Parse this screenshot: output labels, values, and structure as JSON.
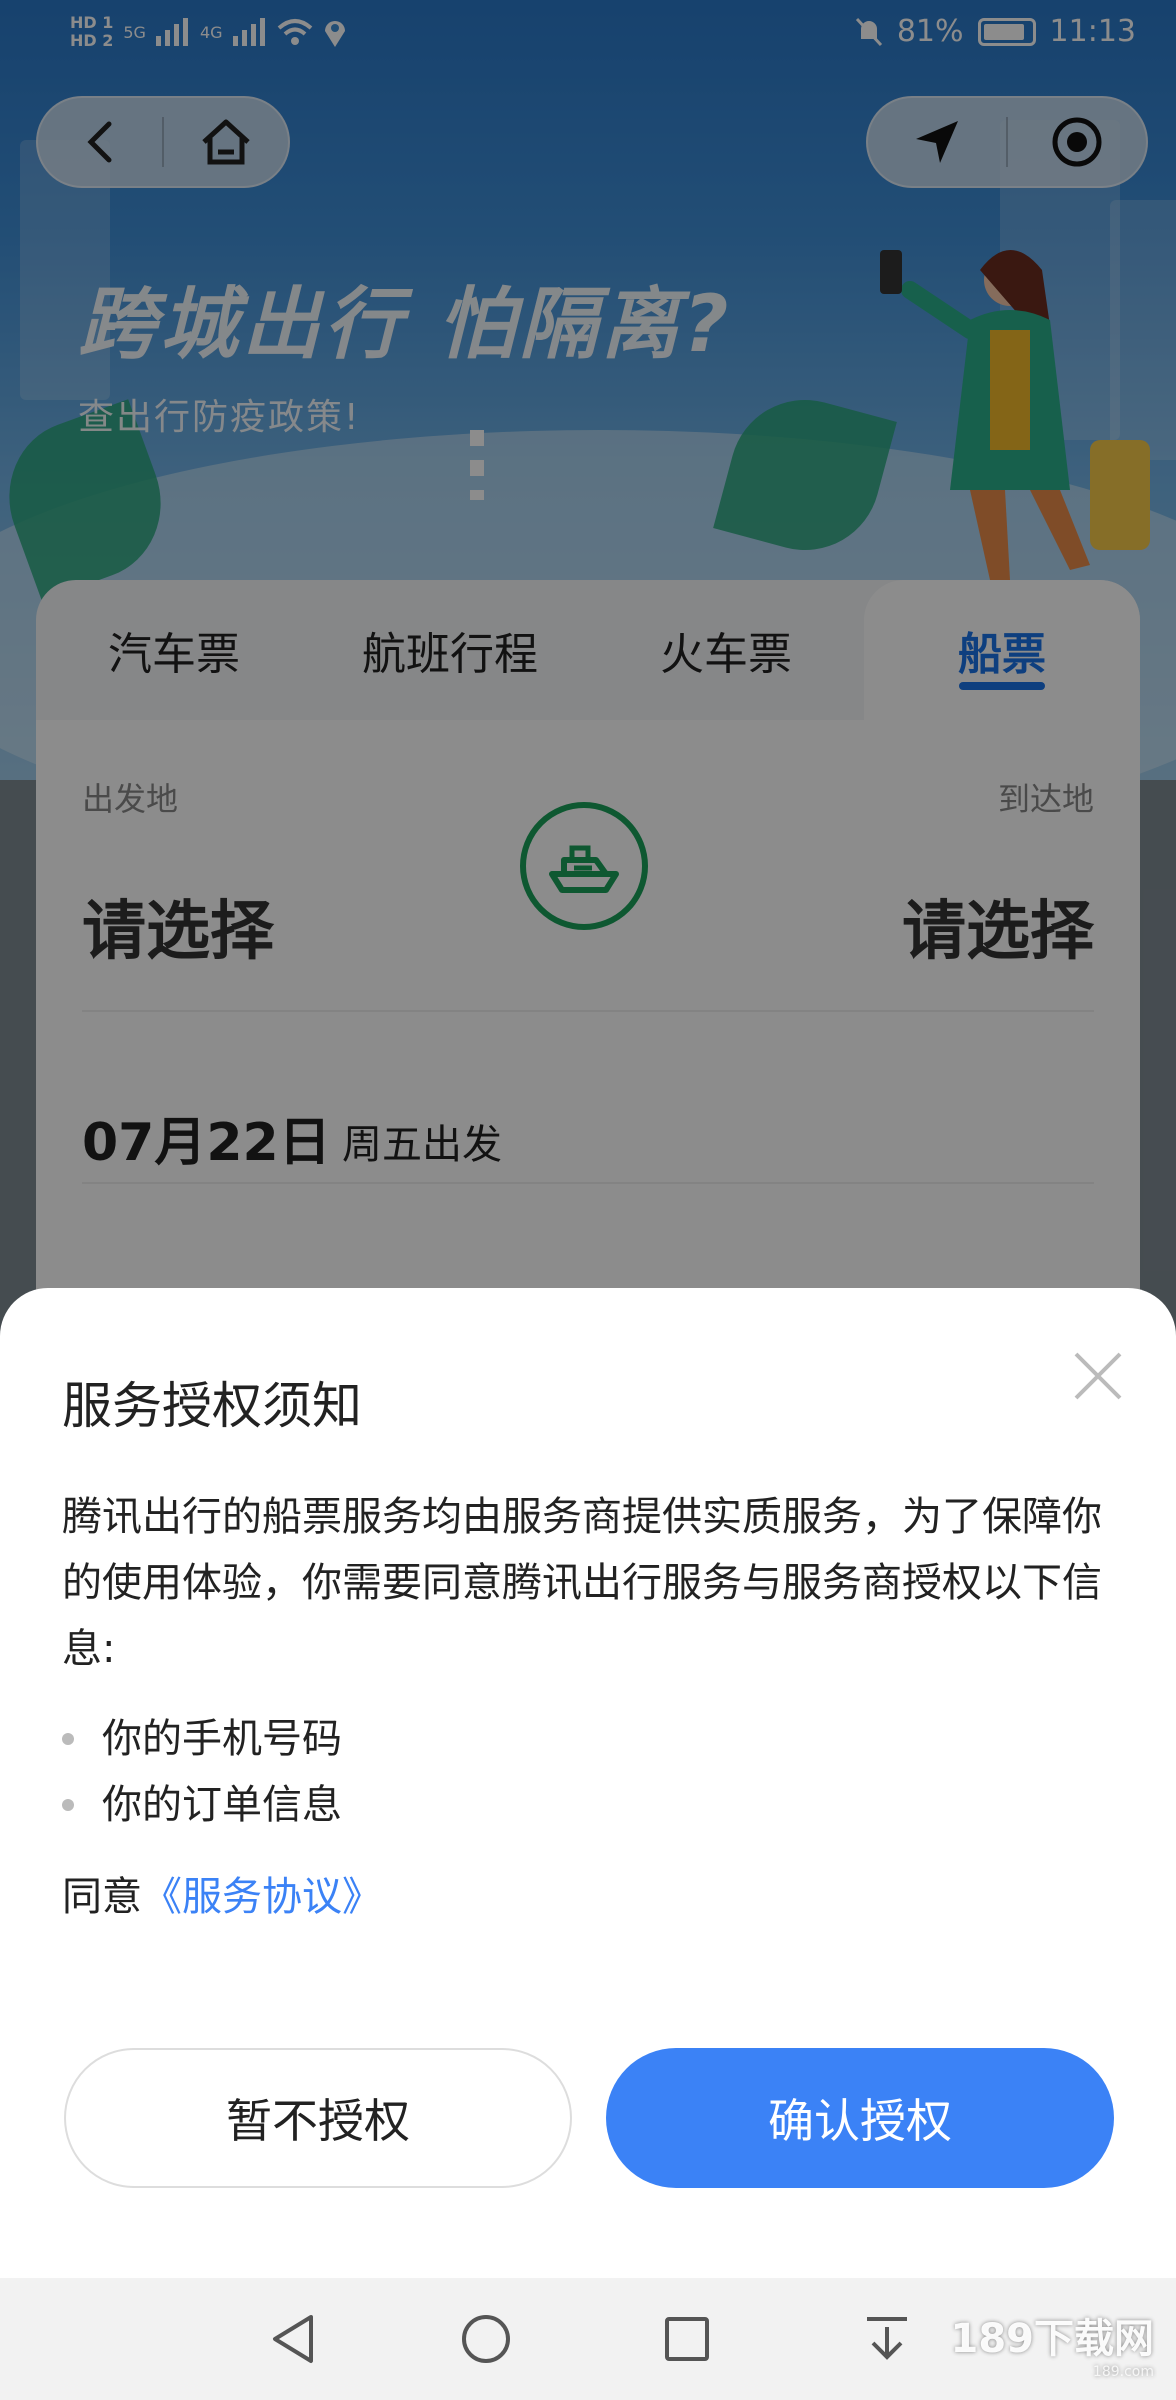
{
  "status_bar": {
    "network_labels": [
      "HD 1",
      "HD 2",
      "5G",
      "4G"
    ],
    "battery": "81%",
    "time": "11:13",
    "icons": [
      "wifi-icon",
      "location-pin-icon",
      "bell-muted-icon",
      "battery-icon"
    ]
  },
  "top_nav": {
    "left_icons": [
      "back-arrow-icon",
      "home-icon"
    ],
    "right_icons": [
      "navigate-arrow-icon",
      "record-target-icon"
    ]
  },
  "hero": {
    "headline": "跨城出行 怕隔离?",
    "subline": "查出行防疫政策!"
  },
  "tabs": [
    {
      "label": "汽车票",
      "active": false
    },
    {
      "label": "航班行程",
      "active": false
    },
    {
      "label": "火车票",
      "active": false
    },
    {
      "label": "船票",
      "active": true
    }
  ],
  "booking": {
    "from_label": "出发地",
    "to_label": "到达地",
    "from_value": "请选择",
    "to_value": "请选择",
    "date": "07月22日",
    "weekday": "周五出发"
  },
  "sheet": {
    "title": "服务授权须知",
    "body": "腾讯出行的船票服务均由服务商提供实质服务，为了保障你的使用体验，你需要同意腾讯出行服务与服务商授权以下信息:",
    "items": [
      "你的手机号码",
      "你的订单信息"
    ],
    "agree_prefix": "同意",
    "agree_link": "《服务协议》",
    "deny_button": "暂不授权",
    "confirm_button": "确认授权"
  },
  "colors": {
    "accent_blue": "#3b82f6",
    "tab_blue": "#1a73e8",
    "green": "#1aa05a"
  },
  "system_nav": [
    "back-triangle-icon",
    "home-circle-icon",
    "recents-square-icon",
    "pull-down-icon"
  ],
  "watermark": {
    "main": "189下载网",
    "sub": "189.com"
  }
}
